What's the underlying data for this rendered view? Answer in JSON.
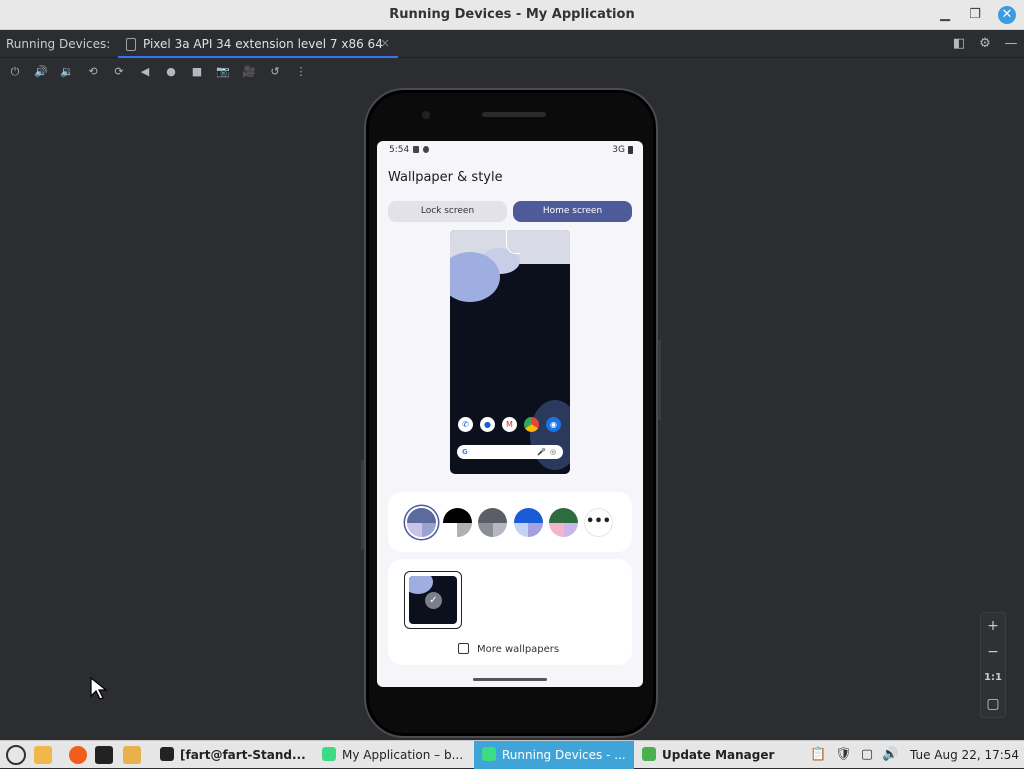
{
  "window": {
    "title": "Running Devices - My Application"
  },
  "tabbar": {
    "label": "Running Devices:",
    "tab_label": "Pixel 3a API 34 extension level 7 x86 64",
    "tab_close": "×"
  },
  "toolbar": {
    "buttons": [
      "power-icon",
      "volume-up-icon",
      "volume-down-icon",
      "rotate-left-icon",
      "rotate-right-icon",
      "back-icon",
      "home-icon",
      "overview-icon",
      "screenshot-icon",
      "screen-record-icon",
      "reset-icon",
      "more-vert-icon"
    ]
  },
  "device": {
    "status_time": "5:54",
    "status_network": "3G",
    "screen_title": "Wallpaper & style",
    "tabs": {
      "lock": "Lock screen",
      "home": "Home screen"
    },
    "more_label": "•••",
    "more_wallpapers": "More wallpapers",
    "swatches": [
      {
        "top": "#5d6a9e",
        "bl": "#c9c3e8",
        "br": "#9aa3d0"
      },
      {
        "top": "#000000",
        "bl": "#ffffff",
        "br": "#b0b0b0"
      },
      {
        "top": "#5c5e66",
        "bl": "#8c8e97",
        "br": "#b6b8c0"
      },
      {
        "top": "#1a5bd6",
        "bl": "#c6d2f3",
        "br": "#a7a0e0"
      },
      {
        "top": "#2e6b3f",
        "bl": "#f1b7c7",
        "br": "#c9b7ea"
      }
    ]
  },
  "zoom": {
    "plus": "+",
    "minus": "−",
    "one_to_one": "1:1"
  },
  "taskbar": {
    "windows": [
      {
        "label": "[fart@fart-Stand..."
      },
      {
        "label": "My Application – b..."
      },
      {
        "label": "Running Devices - ..."
      },
      {
        "label": "Update Manager"
      }
    ],
    "clock": "Tue Aug 22, 17:54"
  },
  "colors": {
    "accent": "#3574f0",
    "home_tab": "#4d5b9a",
    "active_task": "#3fa5d8"
  }
}
